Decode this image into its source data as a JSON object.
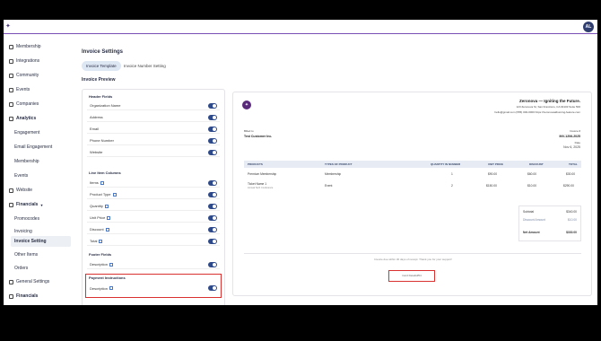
{
  "topbar": {
    "avatar": "AL"
  },
  "sidebar": {
    "membership": "Membership",
    "integrations": "Integrations",
    "community": "Community",
    "events": "Events",
    "companies": "Companies",
    "analytics": "Analytics",
    "analytics_items": [
      "Engagement",
      "Email Engagement",
      "Membership",
      "Events"
    ],
    "website": "Website",
    "financials": "Financials",
    "financials_items": [
      "Promocodes",
      "Invoicing",
      "Invoice Setting",
      "Other Items",
      "Orders"
    ],
    "general_settings": "General Settings",
    "financials_bottom": "Financials"
  },
  "page": {
    "title": "Invoice Settings",
    "tabs": [
      "Invoice Template",
      "Invoice Number Setting"
    ],
    "preview_title": "Invoice Preview"
  },
  "settings": {
    "header_fields_title": "Header Fields",
    "header_fields": [
      "Organization Name",
      "Address",
      "Email",
      "Phone Number",
      "Website"
    ],
    "line_items_title": "Line Item Columns",
    "line_items": [
      "Items",
      "Product Type",
      "Quantity",
      "Unit Price",
      "Discount",
      "Total"
    ],
    "footer_title": "Footer Fields",
    "footer_fields": [
      "Description"
    ],
    "payment_title": "Payment Instructions",
    "payment_fields": [
      "Description"
    ]
  },
  "preview": {
    "org_name": "Zeronova — Igniting the Future.",
    "org_address": "123 Zeronova St, San Francisco, CA 94103 Suite 500",
    "contact_line": "hello@gmail.com   (555) 000-0000   https://zeronovaalbuming-feature.com",
    "billed_to_label": "Billed to",
    "customer": "Test Customer Inc.",
    "invoice_label": "Invoice #",
    "invoice_no": "INV-1206-2025",
    "date_label": "Date",
    "date": "Nov 6, 2025",
    "columns": [
      "PRODUCTS",
      "TYPES OF PRODUCT",
      "QUANTITY IN NUMBER",
      "UNIT PRICE",
      "DISCOUNT",
      "TOTAL"
    ],
    "rows": [
      {
        "product": "Premium Membership",
        "sub": "",
        "type": "Membership",
        "qty": "1",
        "unit": "$90.00",
        "discount": "$60.00",
        "total": "$30.00"
      },
      {
        "product": "Ticket Name 1",
        "sub": "Annual Tech Conference",
        "type": "Event",
        "qty": "2",
        "unit": "$150.00",
        "discount": "$10.00",
        "total": "$290.00"
      }
    ],
    "subtotal_label": "Subtotal",
    "subtotal": "$340.00",
    "discount_label": "Discount Amount",
    "discount": "$10.00",
    "net_label": "Net Amount",
    "net": "$330.00",
    "footer_note": "Invoice due within 30 days of receipt. Thank you for your support!",
    "payment_note": "Card Details#54"
  }
}
